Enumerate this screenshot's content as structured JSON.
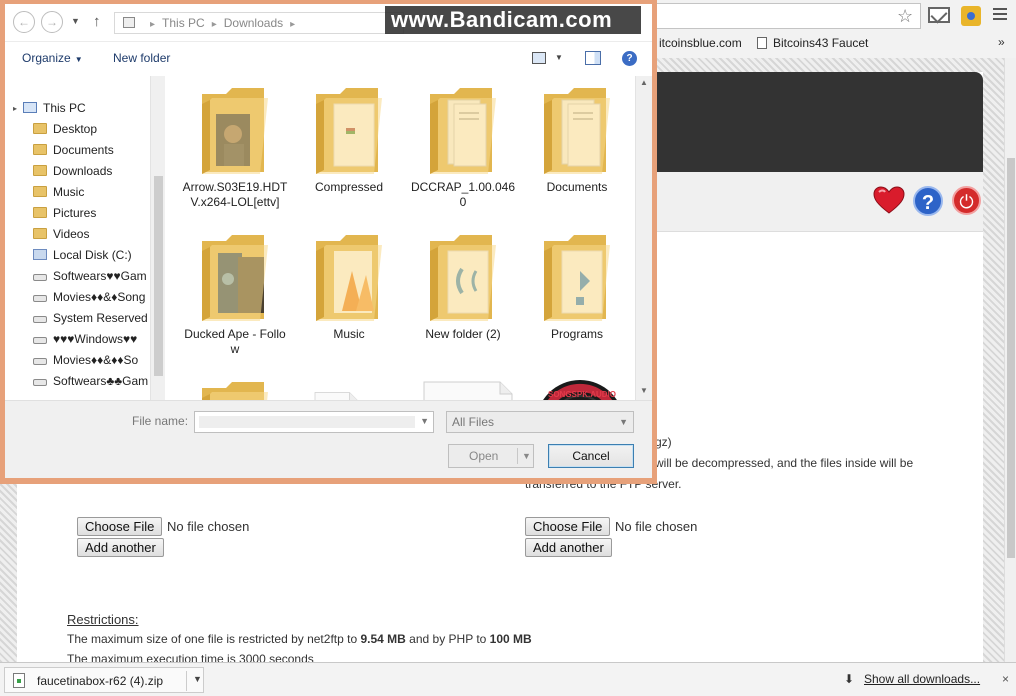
{
  "bookmarks": {
    "item1": "itcoinsblue.com",
    "item2": "Bitcoins43 Faucet",
    "more": "»"
  },
  "page": {
    "hint_line1": "gz)",
    "hint_line2": "will be decompressed, and the files inside will be",
    "hint_line3": "transferred to the FTP server.",
    "choose_file": "Choose File",
    "no_file": "No file chosen",
    "add_another": "Add another",
    "restrictions_title": "Restrictions:",
    "restriction_prefix": "The maximum size of one file is restricted by net2ftp to ",
    "restriction_size1": "9.54 MB",
    "restriction_mid": " and by PHP to ",
    "restriction_size2": "100 MB",
    "restriction_line2": "The maximum execution time is 3000 seconds"
  },
  "downloads": {
    "file_name": "faucetinabox-r62 (4).zip",
    "show_all": "Show all downloads...",
    "close": "×"
  },
  "dialog": {
    "watermark": "www.Bandicam.com",
    "breadcrumb": [
      "This PC",
      "Downloads"
    ],
    "toolbar": {
      "organize": "Organize",
      "new_folder": "New folder"
    },
    "nav_items": [
      {
        "label": "This PC",
        "icon": "pc"
      },
      {
        "label": "Desktop",
        "icon": "folder"
      },
      {
        "label": "Documents",
        "icon": "folder"
      },
      {
        "label": "Downloads",
        "icon": "folder"
      },
      {
        "label": "Music",
        "icon": "folder"
      },
      {
        "label": "Pictures",
        "icon": "folder"
      },
      {
        "label": "Videos",
        "icon": "folder"
      },
      {
        "label": "Local Disk (C:)",
        "icon": "cdrive"
      },
      {
        "label": "Softwears♥♥Gam",
        "icon": "drive"
      },
      {
        "label": "Movies♦♦&♦Song",
        "icon": "drive"
      },
      {
        "label": "System Reserved",
        "icon": "drive"
      },
      {
        "label": "♥♥♥Windows♥♥",
        "icon": "drive"
      },
      {
        "label": "Movies♦♦&♦♦So",
        "icon": "drive"
      },
      {
        "label": "Softwears♣♣Gam",
        "icon": "drive"
      }
    ],
    "files": [
      {
        "label": "Arrow.S03E19.HDTV.x264-LOL[ettv]",
        "preview": "video"
      },
      {
        "label": "Compressed",
        "preview": "doc"
      },
      {
        "label": "DCCRAP_1.00.0460",
        "preview": "stack"
      },
      {
        "label": "Documents",
        "preview": "stack"
      },
      {
        "label": "Ducked Ape - Follow",
        "preview": "photo"
      },
      {
        "label": "Music",
        "preview": "vlc"
      },
      {
        "label": "New folder (2)",
        "preview": "music"
      },
      {
        "label": "Programs",
        "preview": "blue"
      },
      {
        "label": "",
        "preview": "photo2"
      },
      {
        "label": "",
        "preview": "blankfile"
      },
      {
        "label": "",
        "preview": "blankwide"
      },
      {
        "label": "",
        "preview": "disc"
      }
    ],
    "disc_text": "SONGSPK.AUDIO",
    "file_name_label": "File name:",
    "file_type": "All Files",
    "open": "Open",
    "cancel": "Cancel"
  }
}
